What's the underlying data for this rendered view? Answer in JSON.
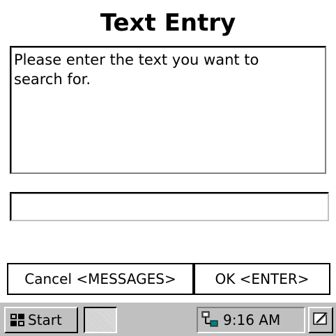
{
  "dialog": {
    "title": "Text Entry",
    "message": "Please enter the text you want to\nsearch for.",
    "entry_value": "",
    "entry_placeholder": ""
  },
  "buttons": {
    "cancel_label": "Cancel <MESSAGES>",
    "ok_label": "OK <ENTER>"
  },
  "taskbar": {
    "start_label": "Start",
    "start_icon": "windows-flag-icon",
    "network_icon": "network-icon",
    "clock": "9:16 AM",
    "desktop_icon": "show-desktop-icon"
  }
}
